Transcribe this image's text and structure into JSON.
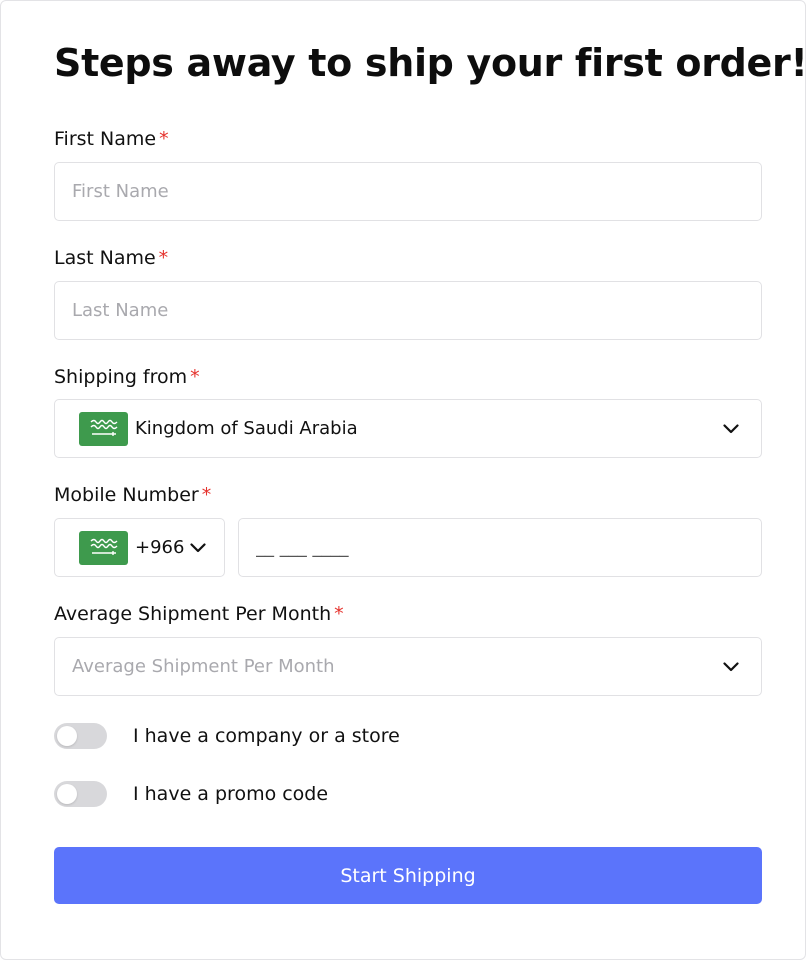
{
  "form": {
    "title": "Steps away to ship your first order!",
    "required_marker": "*",
    "first_name": {
      "label": "First Name",
      "placeholder": "First Name",
      "value": ""
    },
    "last_name": {
      "label": "Last Name",
      "placeholder": "Last Name",
      "value": ""
    },
    "shipping_from": {
      "label": "Shipping from",
      "selected": "Kingdom of Saudi Arabia",
      "flag_icon": "saudi-arabia-flag"
    },
    "mobile": {
      "label": "Mobile Number",
      "country_code": "+966",
      "flag_icon": "saudi-arabia-flag",
      "placeholder": "__ ___ ____",
      "value": ""
    },
    "avg_shipment": {
      "label": "Average Shipment Per Month",
      "placeholder": "Average Shipment Per Month",
      "selected": ""
    },
    "toggles": [
      {
        "label": "I have a company or a store",
        "on": false
      },
      {
        "label": "I have a promo code",
        "on": false
      }
    ],
    "submit_label": "Start Shipping"
  },
  "colors": {
    "accent": "#5b74fb",
    "required": "#e5322d",
    "flag_green": "#3e9a4d",
    "toggle_off": "#d8d8db"
  }
}
